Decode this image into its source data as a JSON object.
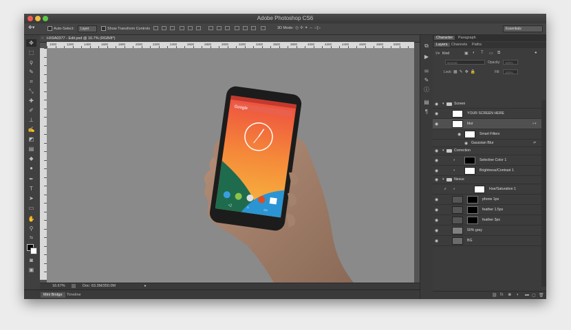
{
  "app": {
    "title": "Adobe Photoshop CS6"
  },
  "options_bar": {
    "auto_select": "Auto-Select:",
    "auto_select_target": "Layer",
    "show_transform": "Show Transform Controls",
    "mode_3d": "3D Mode:",
    "workspace": "Essentials"
  },
  "document": {
    "tab_title": "HX9A0377 - Edit.psd @ 16.7% (RGB/8*)",
    "ruler_ticks": [
      "1000",
      "1200",
      "1400",
      "1600",
      "1800",
      "2000",
      "2200",
      "2400",
      "2600",
      "2800",
      "3000",
      "3200",
      "3400",
      "3600",
      "3800",
      "4000",
      "4200",
      "4400",
      "4600",
      "4800",
      "5000"
    ],
    "zoom": "16.67%",
    "doc_size": "Doc: 63.3M/350.0M"
  },
  "phone": {
    "search_label": "Google"
  },
  "bottom_tabs": [
    {
      "label": "Mini Bridge"
    },
    {
      "label": "Timeline"
    }
  ],
  "panels": {
    "top_tabs": [
      {
        "label": "Character"
      },
      {
        "label": "Paragraph"
      }
    ],
    "layer_tabs": [
      {
        "label": "Layers"
      },
      {
        "label": "Channels"
      },
      {
        "label": "Paths"
      }
    ],
    "kind": "Kind",
    "blend_mode": "Normal",
    "opacity_label": "Opacity:",
    "opacity_value": "100%",
    "lock_label": "Lock:",
    "fill_label": "Fill:",
    "fill_value": "100%"
  },
  "layers": [
    {
      "name": "Screen",
      "type": "group"
    },
    {
      "name": "YOUR SCREEN HERE",
      "type": "smart"
    },
    {
      "name": "blur",
      "type": "smart"
    },
    {
      "name": "Smart Filters",
      "type": "filter"
    },
    {
      "name": "Gaussian Blur",
      "type": "subfilter"
    },
    {
      "name": "Correction",
      "type": "group"
    },
    {
      "name": "Selective Color 1",
      "type": "adjust"
    },
    {
      "name": "Brightness/Contrast 1",
      "type": "adjust"
    },
    {
      "name": "Nexus",
      "type": "group"
    },
    {
      "name": "Hue/Saturation 1",
      "type": "adjust-clip"
    },
    {
      "name": "phone 1px",
      "type": "pixel"
    },
    {
      "name": "feather 1.5px",
      "type": "pixel"
    },
    {
      "name": "feather 3px",
      "type": "pixel"
    },
    {
      "name": "50% gray",
      "type": "gray"
    },
    {
      "name": "BG",
      "type": "pixel"
    }
  ],
  "colors": {
    "accent": "#ef5a3a",
    "window_bg": "#3c3c3c",
    "canvas": "#8a8a8a"
  }
}
